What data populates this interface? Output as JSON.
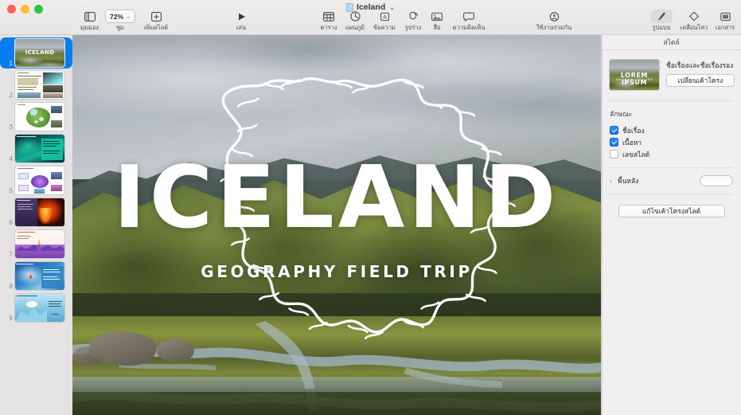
{
  "window": {
    "document_title": "Iceland",
    "title_chevron": "⌄",
    "traffic_lights": [
      "close",
      "minimize",
      "maximize"
    ]
  },
  "toolbar": {
    "left_group": [
      {
        "name": "view",
        "label": "มุมมอง",
        "icon": "sidebar-view-icon"
      },
      {
        "name": "zoom",
        "label": "ซูม",
        "icon": "zoom-control",
        "value": "72%",
        "chevron": "⌄"
      },
      {
        "name": "add-slide",
        "label": "เพิ่มสไลด์",
        "icon": "plus-square-icon"
      }
    ],
    "play_group": [
      {
        "name": "play",
        "label": "เล่น",
        "icon": "play-triangle-icon"
      }
    ],
    "insert_group": [
      {
        "name": "table",
        "label": "ตาราง",
        "icon": "table-grid-icon"
      },
      {
        "name": "chart",
        "label": "แผนภูมิ",
        "icon": "chart-pie-icon"
      },
      {
        "name": "text",
        "label": "ข้อความ",
        "icon": "text-box-icon"
      },
      {
        "name": "shape",
        "label": "รูปร่าง",
        "icon": "shapes-icon"
      },
      {
        "name": "media",
        "label": "สื่อ",
        "icon": "media-photo-icon"
      },
      {
        "name": "comment",
        "label": "ความคิดเห็น",
        "icon": "comment-bubble-icon"
      }
    ],
    "collaborate_group": [
      {
        "name": "collaborate",
        "label": "ใช้งานร่วมกัน",
        "icon": "collaborate-person-icon"
      }
    ],
    "right_group": [
      {
        "name": "format",
        "label": "รูปแบบ",
        "icon": "paintbrush-icon",
        "active": true
      },
      {
        "name": "animate",
        "label": "เคลื่อนไหว",
        "icon": "diamond-animate-icon",
        "active": false
      },
      {
        "name": "document",
        "label": "เอกสาร",
        "icon": "document-icon",
        "active": false
      }
    ]
  },
  "sidebar": {
    "slides": [
      {
        "number": "1",
        "selected": true,
        "kind": "title-photo",
        "title": "ICELAND"
      },
      {
        "number": "2",
        "selected": false,
        "kind": "text-photos"
      },
      {
        "number": "3",
        "selected": false,
        "kind": "map"
      },
      {
        "number": "4",
        "selected": false,
        "kind": "aurora"
      },
      {
        "number": "5",
        "selected": false,
        "kind": "diagram"
      },
      {
        "number": "6",
        "selected": false,
        "kind": "volcano"
      },
      {
        "number": "7",
        "selected": false,
        "kind": "illustration"
      },
      {
        "number": "8",
        "selected": false,
        "kind": "wave"
      },
      {
        "number": "9",
        "selected": false,
        "kind": "iceberg"
      }
    ]
  },
  "canvas": {
    "slide": {
      "title": "ICELAND",
      "subtitle": "GEOGRAPHY FIELD TRIP",
      "background_image": "iceland-highlands-photo",
      "overlay_shape": "iceland-country-outline"
    }
  },
  "inspector": {
    "tab_label": "สไตล์",
    "layout": {
      "thumbnail_label": "LOREM IPSUM",
      "thumbnail_sublabel": "GEOGRAPHY FIELD TRIP",
      "name": "ชื่อเรื่องและชื่อเรื่องรอง",
      "change_button": "เปลี่ยนเค้าโครง"
    },
    "appearance": {
      "section_label": "ลักษณะ",
      "options": [
        {
          "label": "ชื่อเรื่อง",
          "checked": true
        },
        {
          "label": "เนื้อหา",
          "checked": true
        },
        {
          "label": "เลขสไลด์",
          "checked": false
        }
      ]
    },
    "background": {
      "disclosure": "›",
      "label": "พื้นหลัง",
      "color": "#fdfdfd"
    },
    "edit_button": "แก้ไขเค้าโครงสไลด์"
  },
  "colors": {
    "accent": "#0a7bf0",
    "toolbar_bg": "#eceaea",
    "sidebar_bg": "#e4e2e2",
    "inspector_bg": "#f1efef",
    "checkbox_on": "#0a72e8"
  }
}
